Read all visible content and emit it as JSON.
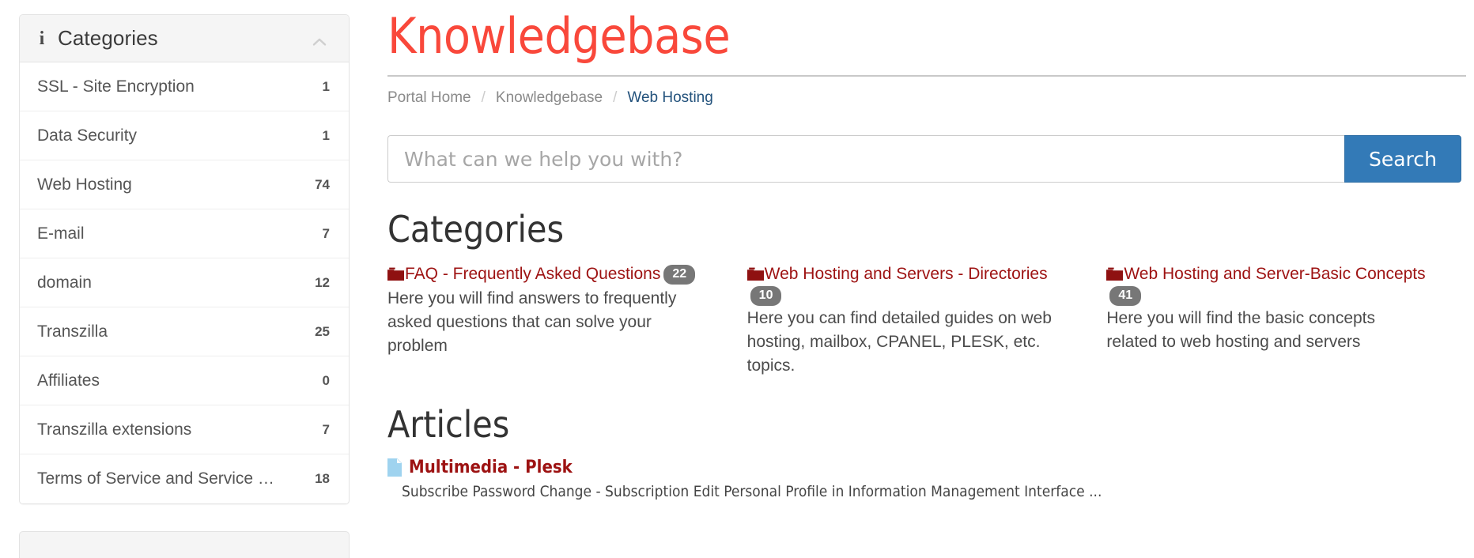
{
  "sidebar": {
    "panel": {
      "title": "Categories",
      "icon": "info-icon",
      "collapse_icon": "chevron-up-icon",
      "items": [
        {
          "label": "SSL - Site Encryption",
          "count": "1"
        },
        {
          "label": "Data Security",
          "count": "1"
        },
        {
          "label": "Web Hosting",
          "count": "74"
        },
        {
          "label": "E-mail",
          "count": "7"
        },
        {
          "label": "domain",
          "count": "12"
        },
        {
          "label": "Transzilla",
          "count": "25"
        },
        {
          "label": "Affiliates",
          "count": "0"
        },
        {
          "label": "Transzilla extensions",
          "count": "7"
        },
        {
          "label": "Terms of Service and Service …",
          "count": "18"
        }
      ]
    }
  },
  "main": {
    "page_title": "Knowledgebase",
    "title_color": "#f9483b",
    "breadcrumb": {
      "separator": "/",
      "items": [
        {
          "label": "Portal Home",
          "active": false
        },
        {
          "label": "Knowledgebase",
          "active": false
        },
        {
          "label": "Web Hosting",
          "active": true
        }
      ]
    },
    "search": {
      "value": "",
      "placeholder": "What can we help you with?",
      "button_label": "Search",
      "button_color": "#337ab7"
    },
    "categories_section": {
      "heading": "Categories",
      "link_color": "#9d1212",
      "badge_color": "#777777",
      "items": [
        {
          "icon": "folder-icon",
          "title": "FAQ - Frequently Asked Questions",
          "count": "22",
          "description": "Here you will find answers to frequently asked questions that can solve your problem"
        },
        {
          "icon": "folder-icon",
          "title": "Web Hosting and Servers - Directories",
          "count": "10",
          "description": "Here you can find detailed guides on web hosting, mailbox, CPANEL, PLESK, etc. topics."
        },
        {
          "icon": "folder-icon",
          "title": "Web Hosting and Server-Basic Concepts",
          "count": "41",
          "description": "Here you will find the basic concepts related to web hosting and servers"
        }
      ]
    },
    "articles_section": {
      "heading": "Articles",
      "items": [
        {
          "icon": "document-icon",
          "title": "Multimedia - Plesk",
          "excerpt": "Subscribe Password Change - Subscription Edit Personal Profile in Information Management Interface ..."
        }
      ]
    }
  }
}
